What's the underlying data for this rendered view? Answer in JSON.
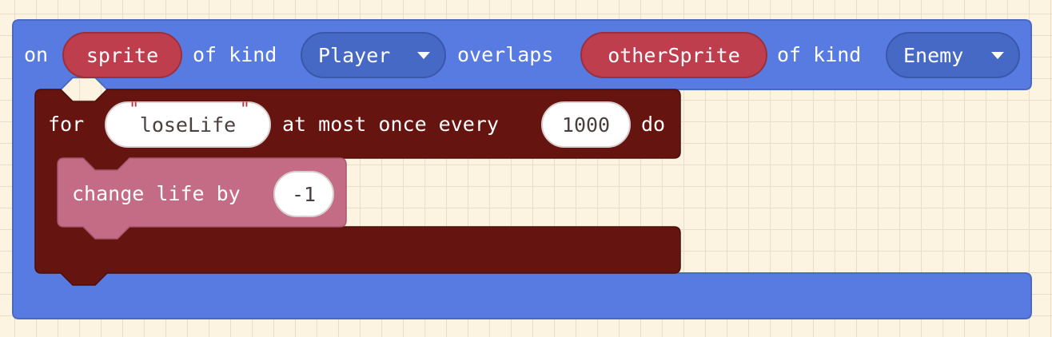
{
  "overlap_block": {
    "on_label": "on",
    "sprite_var": "sprite",
    "of_kind_label_1": "of kind",
    "kind_1": "Player",
    "overlaps_label": "overlaps",
    "other_var": "otherSprite",
    "of_kind_label_2": "of kind",
    "kind_2": "Enemy",
    "color": "#587be2"
  },
  "throttle_block": {
    "for_label": "for",
    "key": "loseLife",
    "quote_open": "\"",
    "quote_close": "\"",
    "at_most_label": "at most once every",
    "interval": "1000",
    "do_label": "do",
    "color": "#65140f"
  },
  "change_life_block": {
    "label": "change life by",
    "value": "-1",
    "color": "#c46c85"
  },
  "workspace": {
    "background": "#fdf3e1",
    "grid_color": "#eaddc8"
  }
}
